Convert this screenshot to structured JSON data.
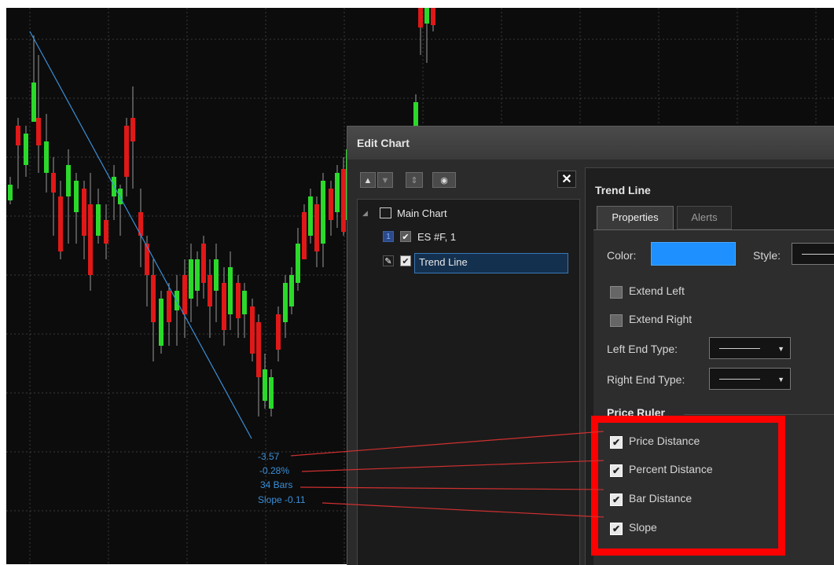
{
  "colors": {
    "up_candle": "#2bd92b",
    "down_candle": "#e01818",
    "trend_line": "#3a8fd8",
    "line_color_swatch": "#1e90ff",
    "highlight": "#ff0000",
    "callout_line": "#d03030"
  },
  "chart": {
    "ruler_labels": {
      "price_distance": "-3.57",
      "percent_distance": "-0.28%",
      "bar_distance": "34 Bars",
      "slope": "Slope -0.11"
    }
  },
  "dialog": {
    "title": "Edit Chart",
    "toolbar": {
      "move_up_icon": "triangle-up-icon",
      "move_down_icon": "triangle-down-icon",
      "reorder_icon": "up-down-arrows-icon",
      "visibility_icon": "eye-icon",
      "close_label": "✕"
    },
    "tree": {
      "items": [
        {
          "label": "Main Chart",
          "icon": "chart-window-icon",
          "expand": "◢"
        },
        {
          "label": "ES #F, 1",
          "icon": "series-icon",
          "badge": "1",
          "checked": true
        },
        {
          "label": "Trend Line",
          "icon": "pencil-icon",
          "checked": true,
          "selected": true
        }
      ]
    },
    "properties": {
      "section_title": "Trend Line",
      "tabs": [
        "Properties",
        "Alerts"
      ],
      "active_tab": "Properties",
      "color_label": "Color:",
      "style_label": "Style:",
      "extend_left_label": "Extend Left",
      "extend_right_label": "Extend Right",
      "left_end_type_label": "Left End Type:",
      "right_end_type_label": "Right End Type:",
      "price_ruler_title": "Price Ruler",
      "price_ruler_options": [
        {
          "label": "Price Distance",
          "checked": true
        },
        {
          "label": "Percent Distance",
          "checked": true
        },
        {
          "label": "Bar Distance",
          "checked": true
        },
        {
          "label": "Slope",
          "checked": true
        }
      ]
    }
  }
}
